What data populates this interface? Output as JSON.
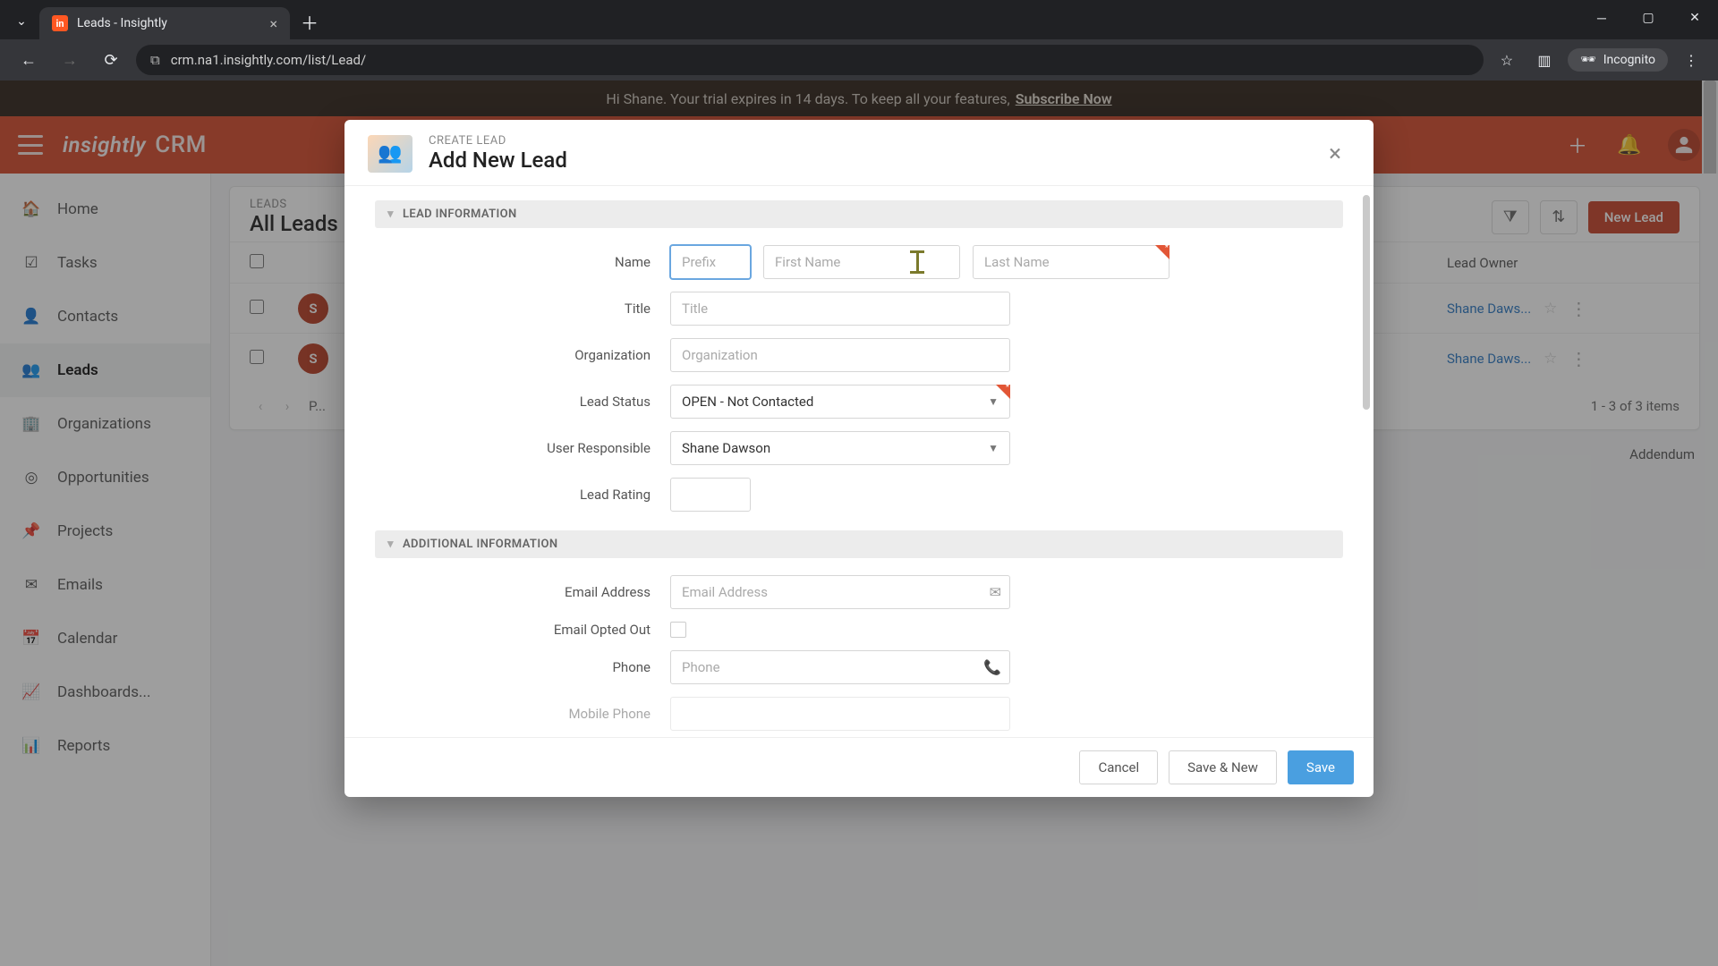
{
  "browser": {
    "tab_title": "Leads - Insightly",
    "url": "crm.na1.insightly.com/list/Lead/",
    "incognito_label": "Incognito"
  },
  "banner": {
    "text": "Hi Shane. Your trial expires in 14 days. To keep all your features,",
    "link": "Subscribe Now"
  },
  "header": {
    "brand": "insightly",
    "product": "CRM"
  },
  "sidebar": {
    "items": [
      {
        "label": "Home"
      },
      {
        "label": "Tasks"
      },
      {
        "label": "Contacts"
      },
      {
        "label": "Leads"
      },
      {
        "label": "Organizations"
      },
      {
        "label": "Opportunities"
      },
      {
        "label": "Projects"
      },
      {
        "label": "Emails"
      },
      {
        "label": "Calendar"
      },
      {
        "label": "Dashboards..."
      },
      {
        "label": "Reports"
      }
    ]
  },
  "list": {
    "crumb": "LEADS",
    "title": "All Leads",
    "new_button": "New Lead",
    "owner_header": "Lead Owner",
    "rows": [
      {
        "initial": "S",
        "owner": "Shane Daws..."
      },
      {
        "initial": "S",
        "owner": "Shane Daws..."
      }
    ],
    "nav_prev": "‹",
    "nav_next": "›",
    "pager_label": "P...",
    "count_text": "1 - 3 of 3 items",
    "addendum": "Addendum"
  },
  "modal": {
    "eyebrow": "CREATE LEAD",
    "title": "Add New Lead",
    "section1": "LEAD INFORMATION",
    "section2": "ADDITIONAL INFORMATION",
    "labels": {
      "name": "Name",
      "title": "Title",
      "organization": "Organization",
      "lead_status": "Lead Status",
      "user_responsible": "User Responsible",
      "lead_rating": "Lead Rating",
      "email_address": "Email Address",
      "email_opted_out": "Email Opted Out",
      "phone": "Phone",
      "mobile_phone": "Mobile Phone"
    },
    "placeholders": {
      "prefix": "Prefix",
      "first_name": "First Name",
      "last_name": "Last Name",
      "title": "Title",
      "organization": "Organization",
      "email": "Email Address",
      "phone": "Phone"
    },
    "values": {
      "lead_status": "OPEN - Not Contacted",
      "user_responsible": "Shane Dawson"
    },
    "footer": {
      "cancel": "Cancel",
      "save_new": "Save & New",
      "save": "Save"
    }
  }
}
